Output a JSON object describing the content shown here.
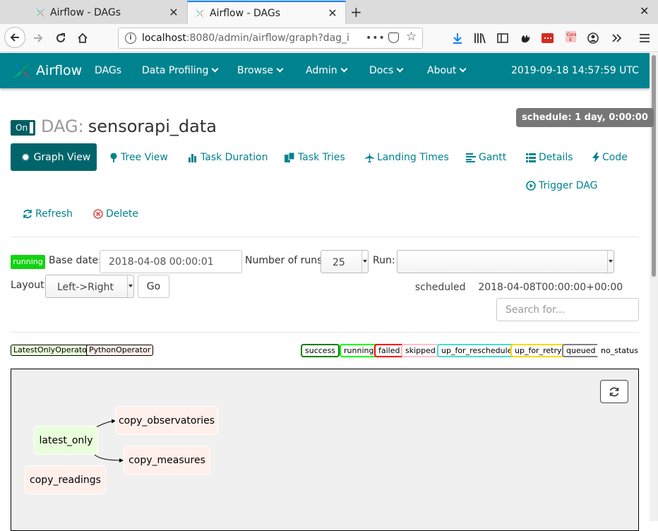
{
  "browser": {
    "tabs": [
      {
        "title": "Airflow - DAGs",
        "active": false
      },
      {
        "title": "Airflow - DAGs",
        "active": true
      }
    ],
    "url_host": "localhost",
    "url_rest": ":8080/admin/airflow/graph?dag_i",
    "url_dots": "•••",
    "new_tab": "+",
    "close_window": "✕"
  },
  "nav": {
    "brand": "Airflow",
    "items": [
      "DAGs",
      "Data Profiling",
      "Browse",
      "Admin",
      "Docs",
      "About"
    ],
    "datetime": "2019-09-18 14:57:59 UTC"
  },
  "dag": {
    "toggle_label": "On",
    "title_label": "DAG:",
    "name": "sensorapi_data",
    "schedule_badge": "schedule: 1 day, 0:00:00"
  },
  "views": {
    "graph": "Graph View",
    "tree": "Tree View",
    "duration": "Task Duration",
    "tries": "Task Tries",
    "landing": "Landing Times",
    "gantt": "Gantt",
    "details": "Details",
    "code": "Code",
    "trigger": "Trigger DAG",
    "refresh": "Refresh",
    "delete": "Delete"
  },
  "form": {
    "state_badge": "running",
    "base_date_label": "Base date:",
    "base_date_value": "2018-04-08 00:00:01",
    "num_runs_label": "Number of runs:",
    "num_runs_value": "25",
    "run_label": "Run:",
    "run_value": "scheduled    2018-04-08T00:00:00+00:00",
    "layout_label": "Layout:",
    "layout_value": "Left->Right",
    "go_label": "Go",
    "search_placeholder": "Search for..."
  },
  "operator_legend": [
    {
      "name": "LatestOnlyOperator",
      "color": "#e9ffdb"
    },
    {
      "name": "PythonOperator",
      "color": "#ffefeb"
    }
  ],
  "state_legend": [
    {
      "name": "success",
      "color": "#008000"
    },
    {
      "name": "running",
      "color": "#00ff00"
    },
    {
      "name": "failed",
      "color": "#ff0000"
    },
    {
      "name": "skipped",
      "color": "#ffc0cb"
    },
    {
      "name": "up_for_reschedule",
      "color": "#40e0d0"
    },
    {
      "name": "up_for_retry",
      "color": "#ffd700"
    },
    {
      "name": "queued",
      "color": "#808080"
    },
    {
      "name": "no_status",
      "color": "#ffffff"
    }
  ],
  "graph": {
    "nodes": [
      {
        "id": "latest_only",
        "color": "#e9ffdb"
      },
      {
        "id": "copy_observatories",
        "color": "#ffefeb"
      },
      {
        "id": "copy_measures",
        "color": "#ffefeb"
      },
      {
        "id": "copy_readings",
        "color": "#ffefeb"
      }
    ]
  },
  "colors": {
    "navbar": "#00838f",
    "accent": "#00656b",
    "link": "#00838f",
    "delete": "#d9534f"
  }
}
